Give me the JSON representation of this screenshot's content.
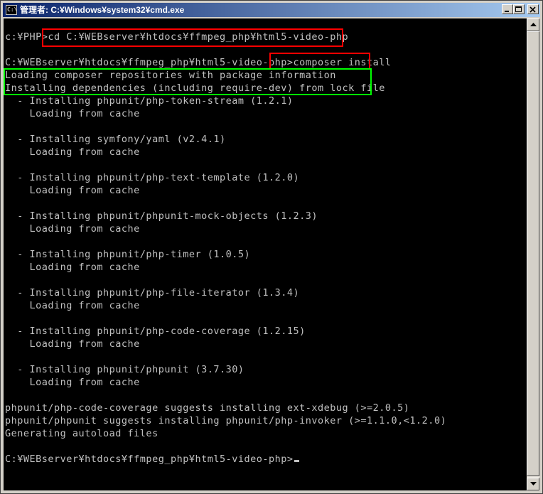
{
  "window": {
    "title": "管理者: C:¥Windows¥system32¥cmd.exe",
    "icon_name": "console-icon",
    "icon_label": "C:\\",
    "buttons": [
      "minimize",
      "maximize",
      "close"
    ]
  },
  "console": {
    "lines": [
      "c:¥PHP>cd C:¥WEBserver¥htdocs¥ffmpeg_php¥html5-video-php",
      "",
      "C:¥WEBserver¥htdocs¥ffmpeg_php¥html5-video-php>composer install",
      "Loading composer repositories with package information",
      "Installing dependencies (including require-dev) from lock file",
      "  - Installing phpunit/php-token-stream (1.2.1)",
      "    Loading from cache",
      "",
      "  - Installing symfony/yaml (v2.4.1)",
      "    Loading from cache",
      "",
      "  - Installing phpunit/php-text-template (1.2.0)",
      "    Loading from cache",
      "",
      "  - Installing phpunit/phpunit-mock-objects (1.2.3)",
      "    Loading from cache",
      "",
      "  - Installing phpunit/php-timer (1.0.5)",
      "    Loading from cache",
      "",
      "  - Installing phpunit/php-file-iterator (1.3.4)",
      "    Loading from cache",
      "",
      "  - Installing phpunit/php-code-coverage (1.2.15)",
      "    Loading from cache",
      "",
      "  - Installing phpunit/phpunit (3.7.30)",
      "    Loading from cache",
      "",
      "phpunit/php-code-coverage suggests installing ext-xdebug (>=2.0.5)",
      "phpunit/phpunit suggests installing phpunit/php-invoker (>=1.1.0,<1.2.0)",
      "Generating autoload files",
      "",
      "C:¥WEBserver¥htdocs¥ffmpeg_php¥html5-video-php>"
    ]
  },
  "colors": {
    "console_bg": "#000000",
    "console_text": "#c0c0c0",
    "title_gradient_start": "#0a246a",
    "title_gradient_end": "#a6caf0",
    "highlight_red": "#ff0000",
    "highlight_green": "#00ff00"
  }
}
